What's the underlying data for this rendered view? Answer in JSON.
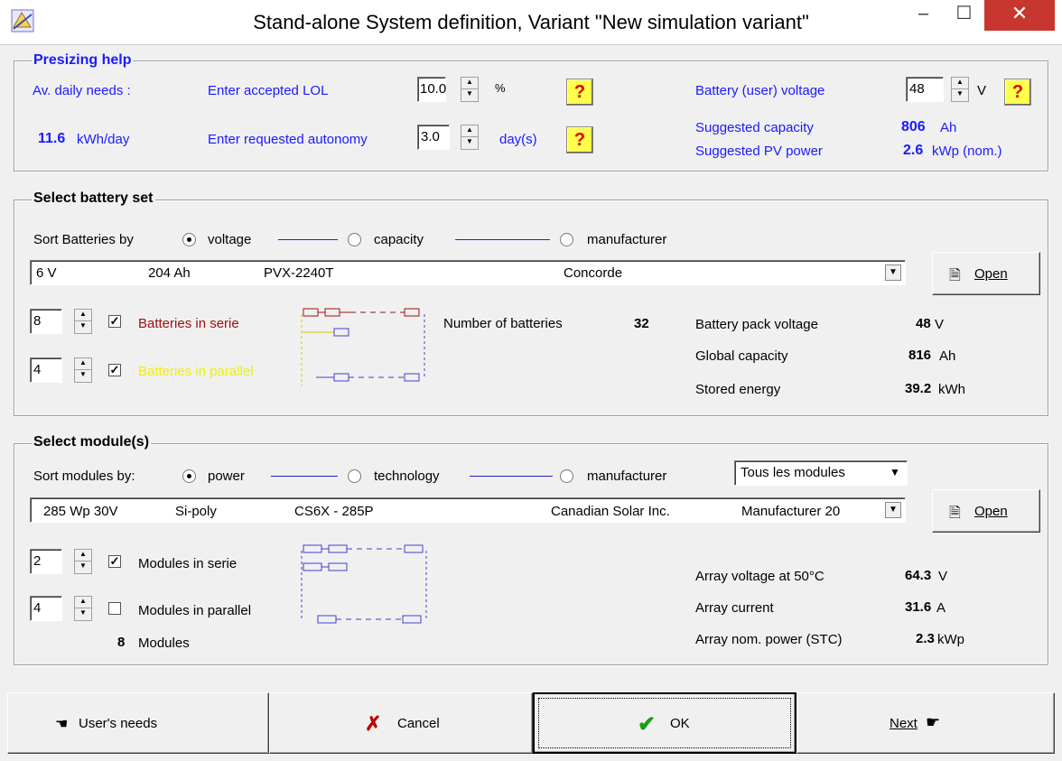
{
  "window": {
    "title": "Stand-alone System definition, Variant  \"New simulation variant\"",
    "minimize": "–",
    "maximize": "☐",
    "close": "✕"
  },
  "presizing": {
    "group_label": "Presizing help",
    "daily_needs_label": "Av. daily needs :",
    "daily_needs_value": "11.6",
    "daily_needs_unit": "kWh/day",
    "lol_label": "Enter accepted LOL",
    "lol_value": "10.0",
    "lol_unit": "%",
    "autonomy_label": "Enter requested autonomy",
    "autonomy_value": "3.0",
    "autonomy_unit": "day(s)",
    "help": "?",
    "voltage_label": "Battery (user) voltage",
    "voltage_value": "48",
    "voltage_unit": "V",
    "sugg_capacity_label": "Suggested capacity",
    "sugg_capacity_value": "806",
    "sugg_capacity_unit": "Ah",
    "sugg_pv_label": "Suggested PV power",
    "sugg_pv_value": "2.6",
    "sugg_pv_unit": "kWp (nom.)"
  },
  "battery": {
    "group_label": "Select battery set",
    "sort_label": "Sort Batteries by",
    "sort_options": [
      "voltage",
      "capacity",
      "manufacturer"
    ],
    "selected": {
      "voltage": "6 V",
      "capacity": "204 Ah",
      "model": "PVX-2240T",
      "manufacturer": "Concorde"
    },
    "open_label": "Open",
    "serie_value": "8",
    "serie_label": "Batteries in serie",
    "parallel_value": "4",
    "parallel_label": "Batteries in parallel",
    "number_label": "Number of batteries",
    "number_value": "32",
    "pack_voltage_label": "Battery pack voltage",
    "pack_voltage_value": "48",
    "pack_voltage_unit": "V",
    "global_capacity_label": "Global capacity",
    "global_capacity_value": "816",
    "global_capacity_unit": "Ah",
    "stored_energy_label": "Stored energy",
    "stored_energy_value": "39.2",
    "stored_energy_unit": "kWh"
  },
  "modules": {
    "group_label": "Select module(s)",
    "sort_label": "Sort modules by:",
    "sort_options": [
      "power",
      "technology",
      "manufacturer"
    ],
    "filter_value": "Tous les modules",
    "selected": {
      "power": "285 Wp 30V",
      "tech": "Si-poly",
      "model": "CS6X - 285P",
      "manufacturer": "Canadian Solar Inc.",
      "source": "Manufacturer 20"
    },
    "open_label": "Open",
    "serie_value": "2",
    "serie_label": "Modules in serie",
    "parallel_value": "4",
    "parallel_label": "Modules in parallel",
    "count_value": "8",
    "count_label": "Modules",
    "array_voltage_label": "Array voltage at 50°C",
    "array_voltage_value": "64.3",
    "array_voltage_unit": "V",
    "array_current_label": "Array current",
    "array_current_value": "31.6",
    "array_current_unit": "A",
    "array_power_label": "Array nom. power (STC)",
    "array_power_value": "2.3",
    "array_power_unit": "kWp"
  },
  "buttons": {
    "users_needs": "User's needs",
    "cancel": "Cancel",
    "ok": "OK",
    "next": "Next"
  },
  "colors": {
    "accent_blue": "#1a1aff",
    "serie_red": "#a01010",
    "parallel_yellow": "#f0f000",
    "close_red": "#c7372f",
    "ok_green": "#18a018"
  }
}
